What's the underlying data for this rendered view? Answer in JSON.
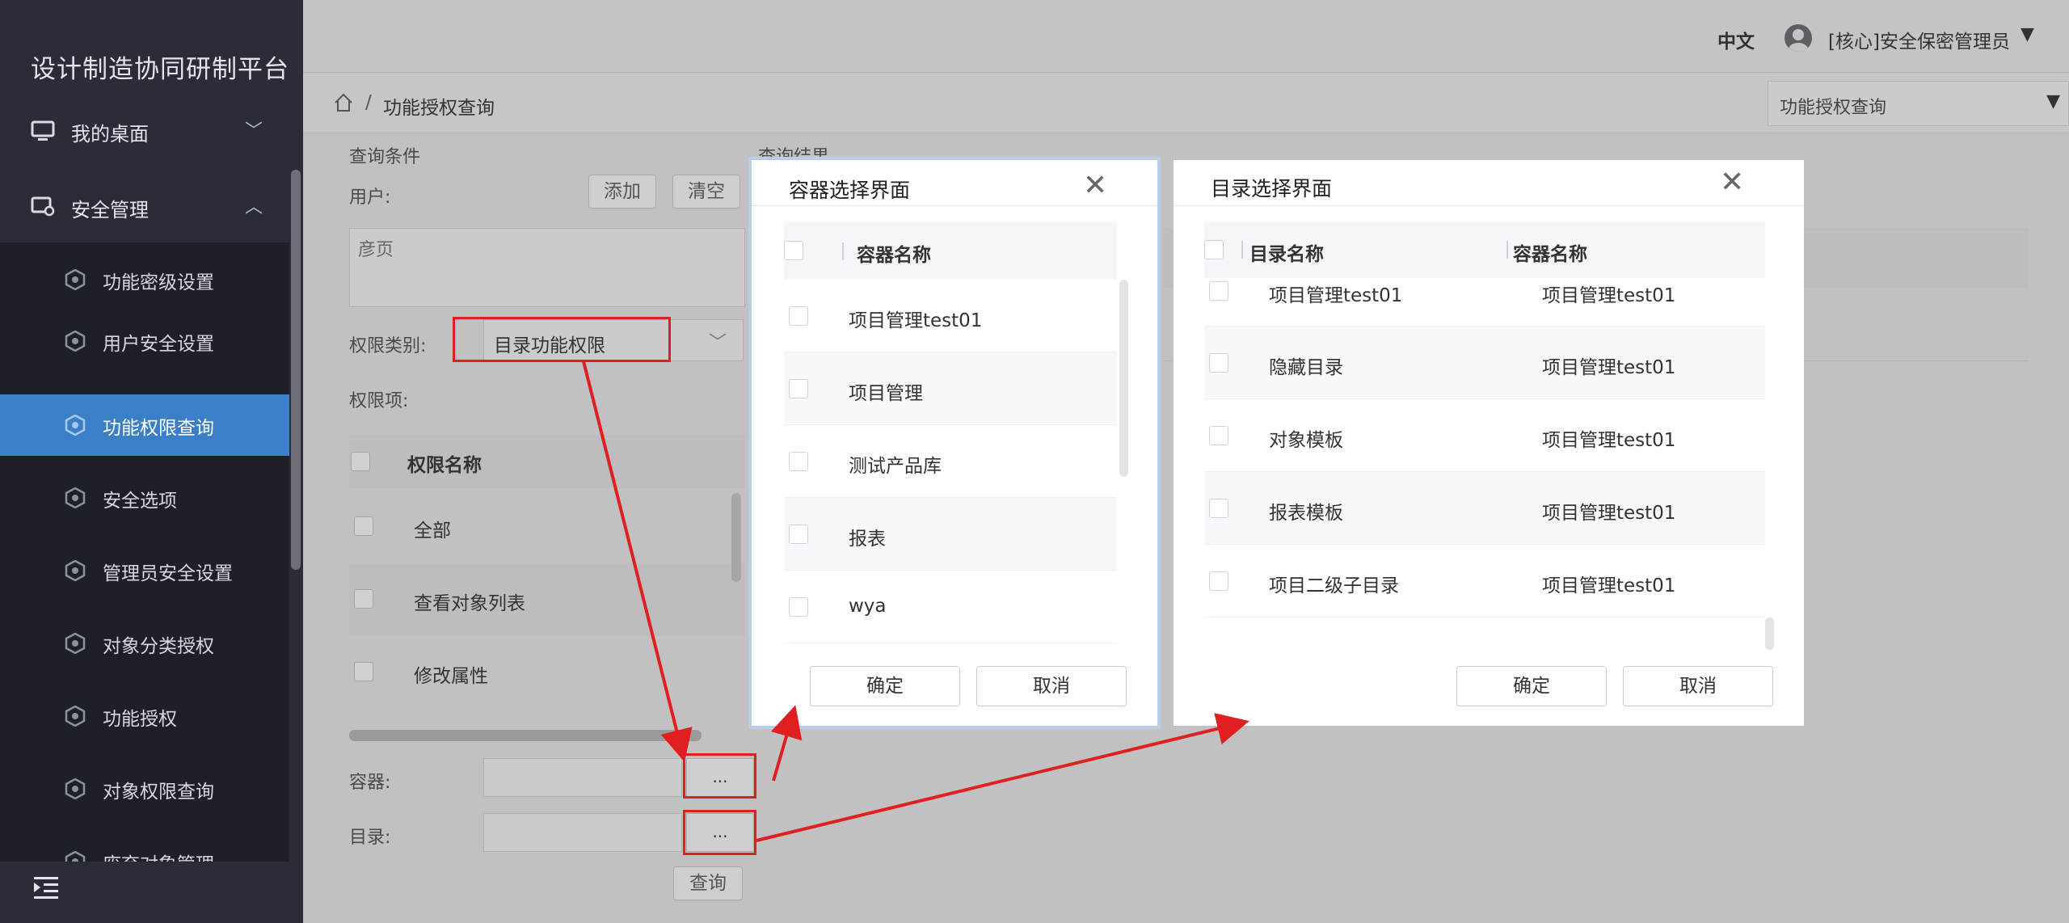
{
  "app": {
    "title": "设计制造协同研制平台"
  },
  "sidebar": {
    "top_items": [
      {
        "label": "我的桌面",
        "icon": "monitor-icon",
        "chevron": "﹀"
      },
      {
        "label": "安全管理",
        "icon": "gear-card-icon",
        "chevron": "︿"
      }
    ],
    "sub_items": [
      {
        "label": "功能密级设置"
      },
      {
        "label": "用户安全设置"
      },
      {
        "label": "功能权限查询",
        "active": true
      },
      {
        "label": "安全选项"
      },
      {
        "label": "管理员安全设置"
      },
      {
        "label": "对象分类授权"
      },
      {
        "label": "功能授权"
      },
      {
        "label": "对象权限查询"
      },
      {
        "label": "废弃对象管理"
      }
    ],
    "collapse_icon": "menu-fold-icon"
  },
  "header": {
    "language": "中文",
    "user_name": "[核心]安全保密管理员",
    "caret": "▼"
  },
  "breadcrumb": {
    "separator": "/",
    "current": "功能授权查询"
  },
  "tab_select": {
    "value": "功能授权查询",
    "caret": "▼"
  },
  "query": {
    "section_title": "查询条件",
    "result_title": "查询结果",
    "user_label": "用户:",
    "add_label": "添加",
    "clear_label": "清空",
    "user_value": "彦页",
    "perm_type_label": "权限类别:",
    "perm_type_value": "目录功能权限",
    "perm_items_label": "权限项:",
    "perm_table": {
      "header": "权限名称",
      "rows": [
        "全部",
        "查看对象列表",
        "修改属性"
      ]
    },
    "container_label": "容器:",
    "directory_label": "目录:",
    "dots_label": "...",
    "query_button": "查询"
  },
  "container_dialog": {
    "title": "容器选择界面",
    "close": "✕",
    "header": "容器名称",
    "rows": [
      "项目管理test01",
      "项目管理",
      "测试产品库",
      "报表",
      "wya"
    ],
    "ok": "确定",
    "cancel": "取消"
  },
  "directory_dialog": {
    "title": "目录选择界面",
    "close": "✕",
    "headers": [
      "目录名称",
      "容器名称"
    ],
    "rows": [
      [
        "项目管理test01",
        "项目管理test01"
      ],
      [
        "隐藏目录",
        "项目管理test01"
      ],
      [
        "对象模板",
        "项目管理test01"
      ],
      [
        "报表模板",
        "项目管理test01"
      ],
      [
        "项目二级子目录",
        "项目管理test01"
      ]
    ],
    "ok": "确定",
    "cancel": "取消"
  },
  "colors": {
    "sidebar_bg": "#2a2d37",
    "active": "#3b7fc8",
    "annotation": "#e02020",
    "overlay": "#c1c1c1"
  }
}
